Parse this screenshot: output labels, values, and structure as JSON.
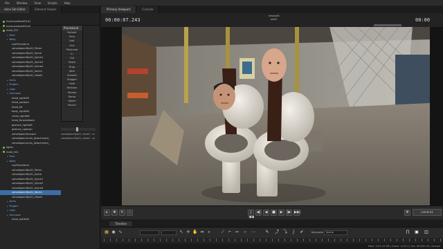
{
  "menubar": {
    "items": [
      "File",
      "Window",
      "View",
      "Scripts",
      "Help"
    ]
  },
  "left_panel": {
    "tabs": [
      "ation Set Editor",
      "Element Viewer"
    ],
    "tree": [
      {
        "label": "furnituredesk001a1",
        "level": 1,
        "dot": true
      },
      {
        "label": "furnituredesk001a2",
        "level": 1,
        "dot": true
      },
      {
        "label": "male_071",
        "level": 1,
        "dot": true
      },
      {
        "label": "Face",
        "level": 2,
        "blue": true
      },
      {
        "label": "Body",
        "level": 2,
        "blue": true
      },
      {
        "label": "rootTransform",
        "level": 3
      },
      {
        "label": "valvebiped.Bip01_Pelvis",
        "level": 3
      },
      {
        "label": "valvebiped.Bip01_Spine",
        "level": 3
      },
      {
        "label": "valvebiped.Bip01_Spine1",
        "level": 3
      },
      {
        "label": "valvebiped.Bip01_Spine2",
        "level": 3
      },
      {
        "label": "valvebiped.Bip01_Spine4",
        "level": 3
      },
      {
        "label": "valvebiped.Bip01_Neck1",
        "level": 3
      },
      {
        "label": "valvebiped.Bip01_Head1",
        "level": 3
      },
      {
        "label": "Arms",
        "level": 2,
        "blue": true
      },
      {
        "label": "Fingers",
        "level": 2,
        "blue": true
      },
      {
        "label": "Legs",
        "level": 2,
        "blue": true
      },
      {
        "label": "Unknown",
        "level": 2,
        "blue": true
      },
      {
        "label": "head_rightleft",
        "level": 3
      },
      {
        "label": "head_updown",
        "level": 3
      },
      {
        "label": "head_tilt",
        "level": 3
      },
      {
        "label": "body_rightleft",
        "level": 3
      },
      {
        "label": "chest_rightleft",
        "level": 3
      },
      {
        "label": "head_forwardback",
        "level": 3
      },
      {
        "label": "gesture_rightleft",
        "level": 3
      },
      {
        "label": "gesture_updown",
        "level": 3
      },
      {
        "label": "valvebiped.forward",
        "level": 3
      },
      {
        "label": "valvebiped.Anim_Attachment_",
        "level": 3
      },
      {
        "label": "valvebiped.Anim_Attachment_",
        "level": 3
      },
      {
        "label": "lights",
        "level": 1,
        "dot": true
      },
      {
        "label": "male_041",
        "level": 1,
        "dot": true
      },
      {
        "label": "Face",
        "level": 2,
        "blue": true
      },
      {
        "label": "Body",
        "level": 2,
        "blue": true
      },
      {
        "label": "rootTransform",
        "level": 3
      },
      {
        "label": "valvebiped.Bip01_Pelvis",
        "level": 3
      },
      {
        "label": "valvebiped.Bip01_Spine",
        "level": 3
      },
      {
        "label": "valvebiped.Bip01_Spine1",
        "level": 3
      },
      {
        "label": "valvebiped.Bip01_Spine2",
        "level": 3
      },
      {
        "label": "valvebiped.Bip01_Spine4",
        "level": 3
      },
      {
        "label": "valvebiped.Bip01_Neck1",
        "level": 3,
        "selected": true
      },
      {
        "label": "valvebiped.Bip01_Head1",
        "level": 3
      },
      {
        "label": "Arms",
        "level": 2,
        "blue": true
      },
      {
        "label": "Fingers",
        "level": 2,
        "blue": true
      },
      {
        "label": "Legs",
        "level": 2,
        "blue": true
      },
      {
        "label": "Unknown",
        "level": 2,
        "blue": true
      },
      {
        "label": "head_rightleft",
        "level": 3
      }
    ],
    "procedural": {
      "header": "Procedural",
      "items": [
        "Default",
        "Zero",
        "Half",
        "One",
        "Playhead",
        "In",
        "Out",
        "Paste",
        "Drop",
        "Jitter",
        "Smooth",
        "Stagger",
        "Hold",
        "Release",
        "Steady",
        "Ramp",
        "Spline",
        "Round"
      ]
    },
    "proc_list": [
      "valvebiped.Bip01_Head1 - sc",
      "valvebiped.Bip01_Head1 - sc"
    ]
  },
  "viewport": {
    "tabs": [
      "Primary Viewport",
      "Console"
    ],
    "timecode_left": "00:00:07.243",
    "timecode_right": "00:00",
    "session": "session6",
    "shot": "shot1",
    "camera_button": "camera1"
  },
  "transport": {
    "buttons": [
      "|◀◀",
      "◀|",
      "◀",
      "■",
      "▶",
      "|▶",
      "▶▶|"
    ]
  },
  "timeline": {
    "tab": "Timeline",
    "keymode_label": "Keymode",
    "keymode_value": "Spline",
    "status": "Mem: 1022.33 MB | Game: 1133.1 | Fps: 36.5/50.00 | Sample"
  },
  "colors": {
    "selection": "#3b6ea5",
    "accent_green": "#7ac143",
    "blue_group": "#7fb0e8"
  }
}
